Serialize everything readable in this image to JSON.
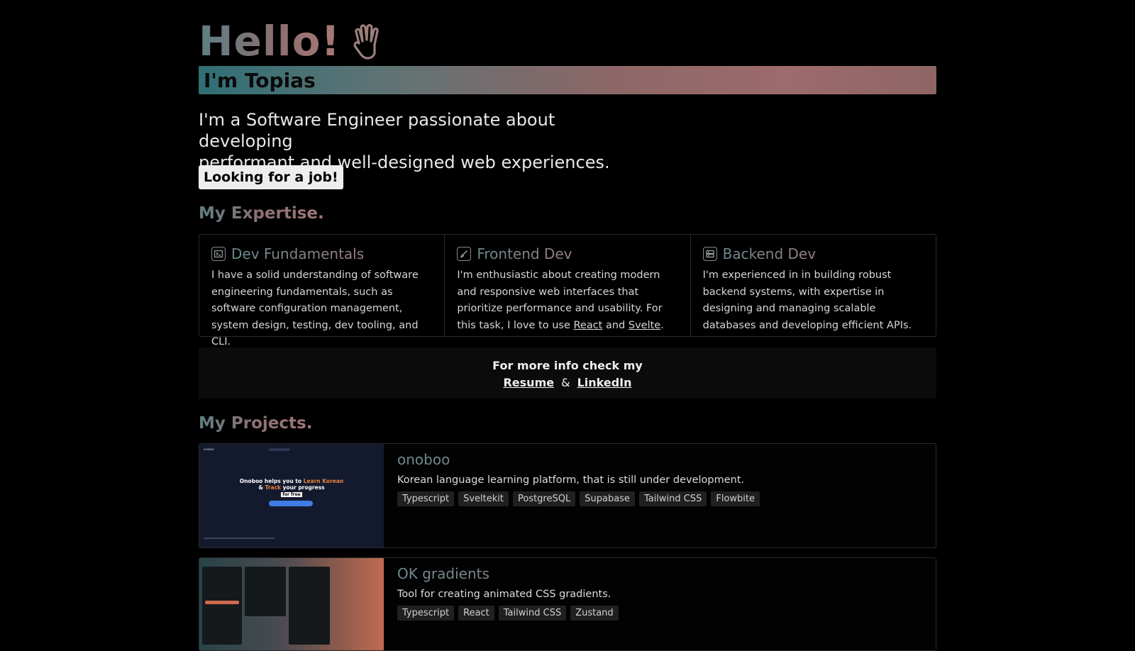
{
  "hero": {
    "greeting": "Hello!",
    "name_banner": "I'm Topias",
    "intro_line1": "I'm a Software Engineer passionate about developing",
    "intro_line2": "performant and well-designed web experiences.",
    "job_button": "Looking for a job!"
  },
  "expertise": {
    "title": "My Expertise.",
    "cards": [
      {
        "icon": "terminal-icon",
        "title": "Dev Fundamentals",
        "text": "I have a solid understanding of software engineering fundamentals, such as software configuration management, system design, testing, dev tooling, and CLI."
      },
      {
        "icon": "brush-icon",
        "title": "Frontend Dev",
        "text_before": "I'm enthusiastic about creating modern and responsive web interfaces that prioritize performance and usability. For this task, I love to use ",
        "link1": "React",
        "and": " and ",
        "link2": "Svelte",
        "text_after": "."
      },
      {
        "icon": "server-icon",
        "title": "Backend Dev",
        "text": "I'm experienced in in building robust backend systems, with expertise in designing and managing scalable databases and developing efficient APIs."
      }
    ]
  },
  "info": {
    "line1": "For more info check my",
    "resume": "Resume",
    "amp": "&",
    "linkedin": "LinkedIn"
  },
  "projects": {
    "title": "My Projects.",
    "items": [
      {
        "name": "onoboo",
        "description": "Korean language learning platform, that is still under development.",
        "tags": [
          "Typescript",
          "Sveltekit",
          "PostgreSQL",
          "Supabase",
          "Tailwind CSS",
          "Flowbite"
        ],
        "thumb": {
          "brand": "onoboo",
          "headline1": "Onoboo helps you to ",
          "accent1": "Learn Korean",
          "headline2": "& ",
          "accent2": "Track",
          "headline3": " your progress",
          "badge": "for free"
        }
      },
      {
        "name": "OK gradients",
        "description": "Tool for creating animated CSS gradients.",
        "tags": [
          "Typescript",
          "React",
          "Tailwind CSS",
          "Zustand"
        ]
      }
    ]
  },
  "colors": {
    "background": "#000000",
    "accent_teal": "#2f6f75",
    "accent_rose": "#9d6b6b",
    "thumb_accent": "#e8833a"
  }
}
